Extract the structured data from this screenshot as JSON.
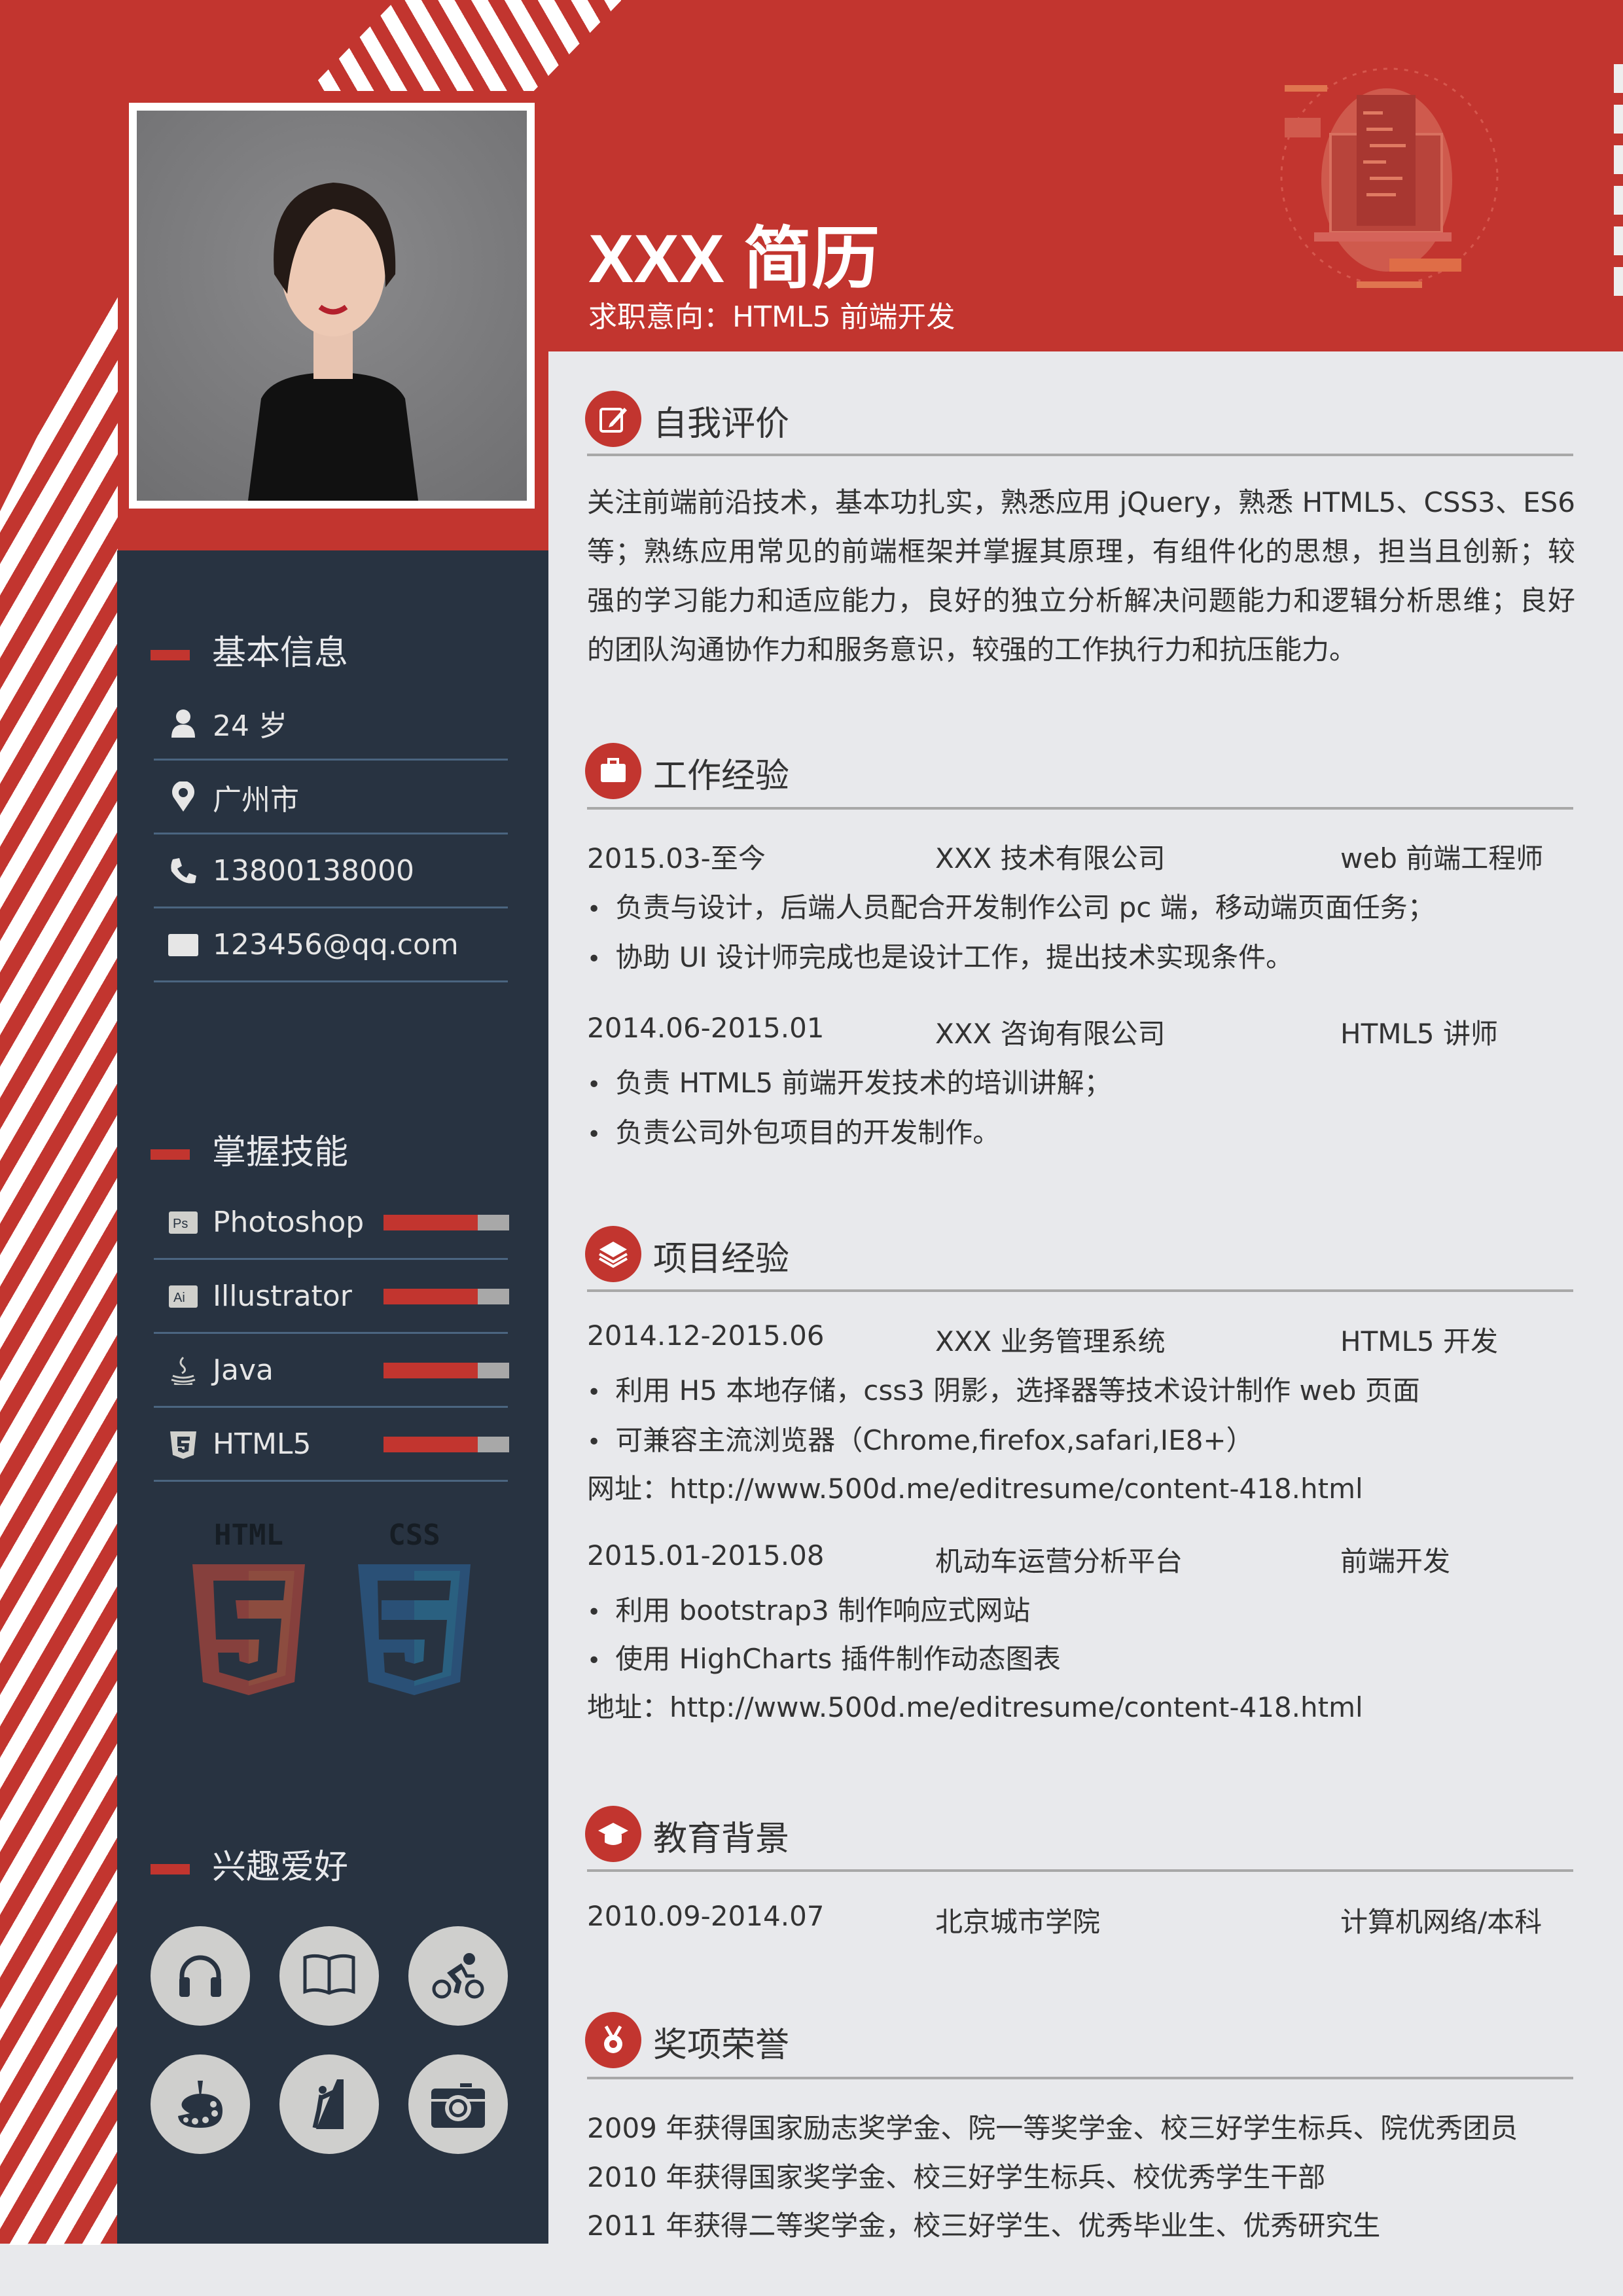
{
  "colors": {
    "accent": "#c2352f",
    "panel": "#283341",
    "background": "#e8e9ec"
  },
  "header": {
    "name": "XXX 简历",
    "intent": "求职意向：HTML5 前端开发"
  },
  "sidebar": {
    "basic": {
      "title": "基本信息",
      "items": [
        {
          "icon": "user-icon",
          "text": "24 岁"
        },
        {
          "icon": "location-icon",
          "text": "广州市"
        },
        {
          "icon": "phone-icon",
          "text": "13800138000"
        },
        {
          "icon": "mail-icon",
          "text": "123456@qq.com"
        }
      ]
    },
    "skills": {
      "title": "掌握技能",
      "items": [
        {
          "icon": "photoshop-icon",
          "name": "Photoshop",
          "level": 0.75
        },
        {
          "icon": "illustrator-icon",
          "name": "Illustrator",
          "level": 0.75
        },
        {
          "icon": "java-icon",
          "name": "Java",
          "level": 0.75
        },
        {
          "icon": "html5-icon",
          "name": "HTML5",
          "level": 0.75
        }
      ],
      "logos": [
        "HTML",
        "CSS"
      ]
    },
    "hobbies": {
      "title": "兴趣爱好",
      "icons": [
        "headphones-icon",
        "book-icon",
        "cycling-icon",
        "painting-icon",
        "climbing-icon",
        "camera-icon"
      ]
    }
  },
  "main": {
    "self": {
      "title": "自我评价",
      "text": "关注前端前沿技术，基本功扎实，熟悉应用 jQuery，熟悉 HTML5、CSS3、ES6 等；熟练应用常见的前端框架并掌握其原理，有组件化的思想，担当且创新；较强的学习能力和适应能力，良好的独立分析解决问题能力和逻辑分析思维；良好的团队沟通协作力和服务意识，较强的工作执行力和抗压能力。"
    },
    "work": {
      "title": "工作经验",
      "entries": [
        {
          "date": "2015.03-至今",
          "org": "XXX 技术有限公司",
          "role": "web 前端工程师",
          "bullets": [
            "负责与设计，后端人员配合开发制作公司 pc 端，移动端页面任务；",
            "协助 UI 设计师完成也是设计工作，提出技术实现条件。"
          ]
        },
        {
          "date": "2014.06-2015.01",
          "org": "XXX 咨询有限公司",
          "role": "HTML5 讲师",
          "bullets": [
            "负责 HTML5 前端开发技术的培训讲解；",
            "负责公司外包项目的开发制作。"
          ]
        }
      ]
    },
    "projects": {
      "title": "项目经验",
      "entries": [
        {
          "date": "2014.12-2015.06",
          "org": "XXX 业务管理系统",
          "role": "HTML5 开发",
          "bullets": [
            "利用 H5 本地存储，css3 阴影，选择器等技术设计制作 web 页面",
            "可兼容主流浏览器（Chrome,firefox,safari,IE8+）"
          ],
          "link": "网址：http://www.500d.me/editresume/content-418.html"
        },
        {
          "date": "2015.01-2015.08",
          "org": "机动车运营分析平台",
          "role": "前端开发",
          "bullets": [
            "利用 bootstrap3 制作响应式网站",
            "使用 HighCharts 插件制作动态图表"
          ],
          "link": "地址：http://www.500d.me/editresume/content-418.html"
        }
      ]
    },
    "education": {
      "title": "教育背景",
      "date": "2010.09-2014.07",
      "school": "北京城市学院",
      "major": "计算机网络/本科"
    },
    "awards": {
      "title": "奖项荣誉",
      "items": [
        "2009 年获得国家励志奖学金、院一等奖学金、校三好学生标兵、院优秀团员",
        "2010 年获得国家奖学金、校三好学生标兵、校优秀学生干部",
        "2011 年获得二等奖学金，校三好学生、优秀毕业生、优秀研究生"
      ]
    }
  }
}
